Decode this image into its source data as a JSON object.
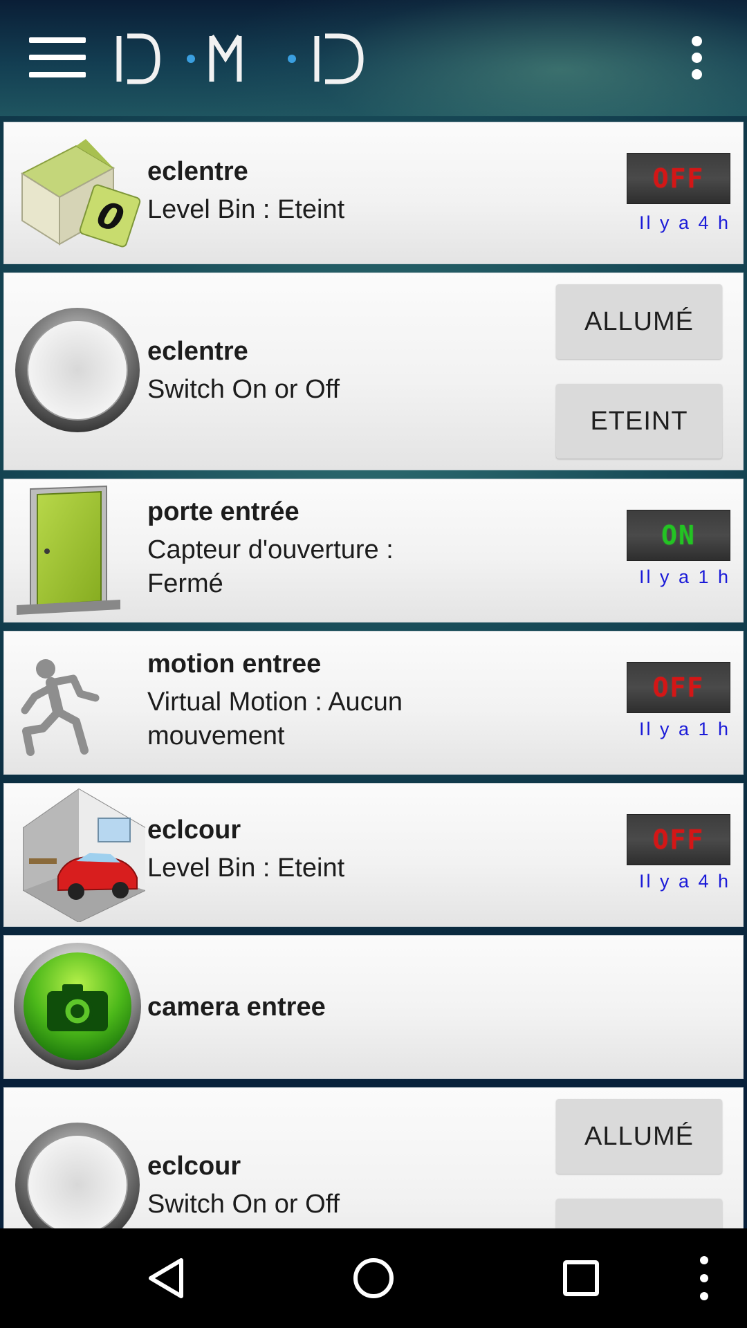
{
  "appbar": {
    "logo_text": "D·M·D",
    "menu_icon": "hamburger-menu-icon",
    "overflow_icon": "more-vertical-icon"
  },
  "devices": [
    {
      "name": "eclentre",
      "subtitle": "Level Bin : Eteint",
      "icon": "box-zero-icon",
      "state": "OFF",
      "time_ago": "Il y a 4 h"
    },
    {
      "name": "eclentre",
      "subtitle": "Switch On or Off",
      "icon": "round-switch-icon",
      "on_label": "ALLUMÉ",
      "off_label": "ETEINT"
    },
    {
      "name": "porte entrée",
      "subtitle": "Capteur d'ouverture : Fermé",
      "icon": "door-icon",
      "state": "ON",
      "time_ago": "Il y a 1 h"
    },
    {
      "name": "motion entree",
      "subtitle": "Virtual Motion : Aucun mouvement",
      "icon": "running-person-icon",
      "state": "OFF",
      "time_ago": "Il y a 1 h"
    },
    {
      "name": "eclcour",
      "subtitle": "Level Bin : Eteint",
      "icon": "garage-car-icon",
      "state": "OFF",
      "time_ago": "Il y a 4 h"
    },
    {
      "name": "camera entree",
      "icon": "camera-icon"
    },
    {
      "name": "eclcour",
      "subtitle": "Switch On or Off",
      "icon": "round-switch-icon",
      "on_label": "ALLUMÉ"
    }
  ],
  "colors": {
    "off_state": "#d41616",
    "on_state": "#23c423",
    "time_ago": "#1a1ad8",
    "logo_dot": "#3a9fe0"
  },
  "navbar": {
    "back_icon": "back-triangle-icon",
    "home_icon": "home-circle-icon",
    "recents_icon": "recents-square-icon",
    "menu_icon": "more-vertical-icon"
  }
}
